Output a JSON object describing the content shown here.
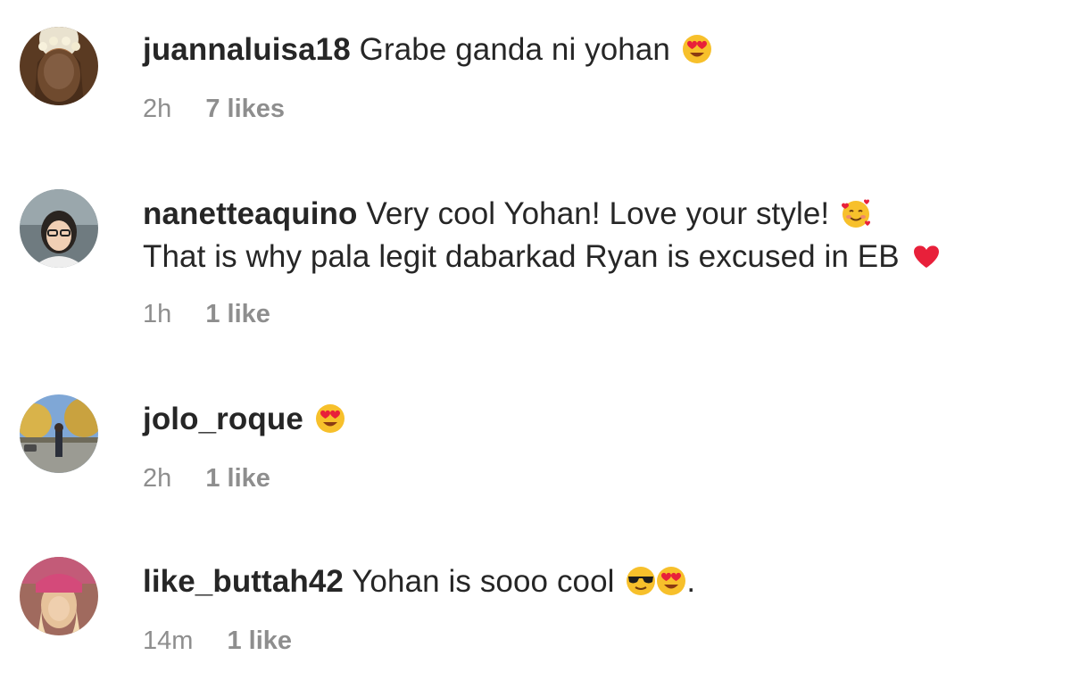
{
  "comments": [
    {
      "username": "juannaluisa18",
      "lines": [
        "Grabe ganda ni yohan"
      ],
      "emojis": [
        "heart-eyes-emoji"
      ],
      "time": "2h",
      "likes": "7 likes"
    },
    {
      "username": "nanetteaquino",
      "lines": [
        "Very cool Yohan! Love your style!",
        "That is why pala legit dabarkad Ryan is excused in EB"
      ],
      "emojis": [
        "smiling-face-with-hearts-emoji",
        "red-heart-emoji"
      ],
      "time": "1h",
      "likes": "1 like"
    },
    {
      "username": "jolo_roque",
      "lines": [
        ""
      ],
      "emojis": [
        "heart-eyes-emoji"
      ],
      "time": "2h",
      "likes": "1 like"
    },
    {
      "username": "like_buttah42",
      "lines": [
        "Yohan is sooo cool"
      ],
      "emojis": [
        "sunglasses-emoji",
        "heart-eyes-emoji"
      ],
      "trailing": ".",
      "time": "14m",
      "likes": "1 like"
    }
  ],
  "colors": {
    "text": "#262626",
    "meta": "#8e8e8e",
    "background": "#ffffff"
  }
}
